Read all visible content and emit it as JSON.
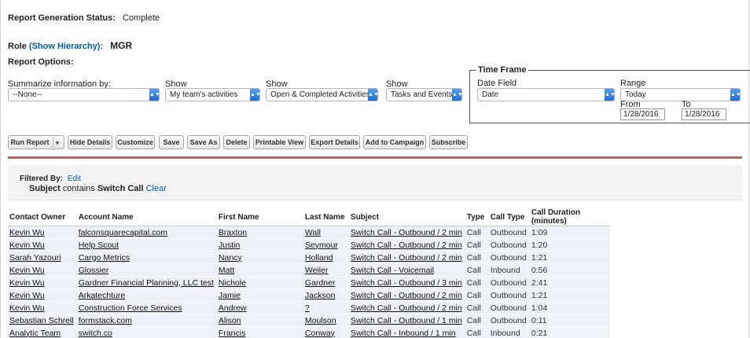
{
  "status": {
    "label": "Report Generation Status:",
    "value": "Complete"
  },
  "role": {
    "label": "Role",
    "hierarchy_link": "(Show Hierarchy):",
    "value": "MGR"
  },
  "options_label": "Report Options:",
  "summarize": {
    "label": "Summarize information by:",
    "value": "--None--"
  },
  "show1": {
    "label": "Show",
    "value": "My team's activities"
  },
  "show2": {
    "label": "Show",
    "value": "Open & Completed Activities"
  },
  "show3": {
    "label": "Show",
    "value": "Tasks and Events"
  },
  "timeframe": {
    "legend": "Time Frame",
    "date_field_label": "Date Field",
    "date_field_value": "Date",
    "range_label": "Range",
    "range_value": "Today",
    "from_label": "From",
    "from_value": "1/28/2016",
    "to_label": "To",
    "to_value": "1/28/2016"
  },
  "buttons": {
    "run_report": "Run Report",
    "hide_details": "Hide Details",
    "customize": "Customize",
    "save": "Save",
    "save_as": "Save As",
    "delete": "Delete",
    "printable_view": "Printable View",
    "export_details": "Export Details",
    "add_to_campaign": "Add to Campaign",
    "subscribe": "Subscribe"
  },
  "filter": {
    "label": "Filtered By:",
    "edit": "Edit",
    "field": "Subject",
    "op": "contains",
    "value": "Switch Call",
    "clear": "Clear"
  },
  "table": {
    "headers": [
      "Contact Owner",
      "Account Name",
      "First Name",
      "Last Name",
      "Subject",
      "Type",
      "Call Type",
      "Call Duration (minutes)"
    ],
    "rows": [
      [
        "Kevin Wu",
        "falconsquarecapital.com",
        "Braxton",
        "Wall",
        "Switch Call - Outbound / 2 min",
        "Call",
        "Outbound",
        "1:09"
      ],
      [
        "Kevin Wu",
        "Help Scout",
        "Justin",
        "Seymour",
        "Switch Call - Outbound / 2 min",
        "Call",
        "Outbound",
        "1:20"
      ],
      [
        "Sarah Yazouri",
        "Cargo Metrics",
        "Nancy",
        "Holland",
        "Switch Call - Outbound / 2 min",
        "Call",
        "Outbound",
        "1:21"
      ],
      [
        "Kevin Wu",
        "Glossier",
        "Matt",
        "Weiler",
        "Switch Call - Voicemail",
        "Call",
        "Inbound",
        "0:56"
      ],
      [
        "Kevin Wu",
        "Gardner Financial Planning, LLC test",
        "Nichole",
        "Gardner",
        "Switch Call - Outbound / 3 min",
        "Call",
        "Outbound",
        "2:41"
      ],
      [
        "Kevin Wu",
        "Arkatechture",
        "Jamie",
        "Jackson",
        "Switch Call - Outbound / 2 min",
        "Call",
        "Outbound",
        "1:21"
      ],
      [
        "Kevin Wu",
        "Construction Force Services",
        "Andrew",
        "?",
        "Switch Call - Outbound / 2 min",
        "Call",
        "Outbound",
        "1:04"
      ],
      [
        "Sebastian Schrell",
        "formstack.com",
        "Alison",
        "Moulson",
        "Switch Call - Outbound / 1 min",
        "Call",
        "Outbound",
        "0:11"
      ],
      [
        "Analytic Team",
        "switch.co",
        "Francis",
        "Conway",
        "Switch Call - Inbound / 1 min",
        "Call",
        "Inbound",
        "0:21"
      ]
    ]
  }
}
